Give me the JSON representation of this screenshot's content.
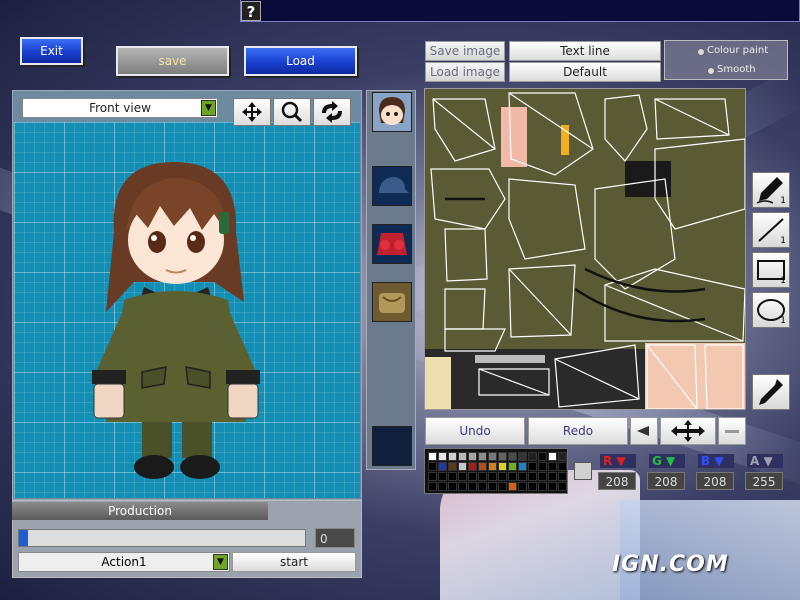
{
  "toolbar": {
    "exit_label": "Exit",
    "save_label": "save",
    "load_label": "Load",
    "help_icon": "?"
  },
  "view": {
    "selected": "Front view",
    "icons": [
      "move-icon",
      "zoom-icon",
      "rotate-icon"
    ]
  },
  "image_buttons": {
    "save_image": "Save image",
    "load_image": "Load image",
    "text_line": "Text line",
    "default": "Default"
  },
  "paint_mode": {
    "colour_paint": "Colour paint",
    "smooth": "Smooth"
  },
  "parts": [
    "face",
    "hat",
    "body",
    "backpack",
    "empty"
  ],
  "edit": {
    "undo": "Undo",
    "redo": "Redo"
  },
  "tools": [
    {
      "name": "pen-icon",
      "size": "1"
    },
    {
      "name": "line-icon",
      "size": "1"
    },
    {
      "name": "rectangle-icon",
      "size": "1"
    },
    {
      "name": "ellipse-icon",
      "size": "1"
    },
    {
      "name": "eyedropper-icon",
      "size": ""
    }
  ],
  "color": {
    "current_hex": "#d0d0d0",
    "r_label": "R",
    "g_label": "G",
    "b_label": "B",
    "a_label": "A",
    "r": "208",
    "g": "208",
    "b": "208",
    "a": "255"
  },
  "production": {
    "title": "Production",
    "progress_value": "0",
    "progress_fraction": 0.03,
    "action": "Action1",
    "start_label": "start"
  },
  "watermark": "IGN.COM",
  "accent_colors": {
    "button_blue": "#1a3fd0",
    "grid_bg": "#138fb5",
    "uniform": "#5a6030",
    "dropdown_green": "#6fa428"
  },
  "palette_colors": [
    "#ffffff",
    "#e6e6e6",
    "#d0d0d0",
    "#bababa",
    "#a4a4a4",
    "#8e8e8e",
    "#787878",
    "#626262",
    "#4c4c4c",
    "#363636",
    "#202020",
    "#0a0a0a",
    "#ffffff",
    "#222222",
    "#000000",
    "#1d3ba8",
    "#5a3a1a",
    "#c8c8c8",
    "#b01818",
    "#b05020",
    "#d08020",
    "#e0d020",
    "#70b020",
    "#2080d0",
    "#000000",
    "#000000",
    "#000000",
    "#000000",
    "#000000",
    "#000000",
    "#000000",
    "#000000",
    "#000000",
    "#000000",
    "#000000",
    "#000000",
    "#000000",
    "#000000",
    "#000000",
    "#000000",
    "#000000",
    "#000000",
    "#000000",
    "#000000",
    "#000000",
    "#000000",
    "#000000",
    "#000000",
    "#000000",
    "#000000",
    "#d86010",
    "#000000",
    "#000000",
    "#000000",
    "#000000",
    "#000000"
  ]
}
